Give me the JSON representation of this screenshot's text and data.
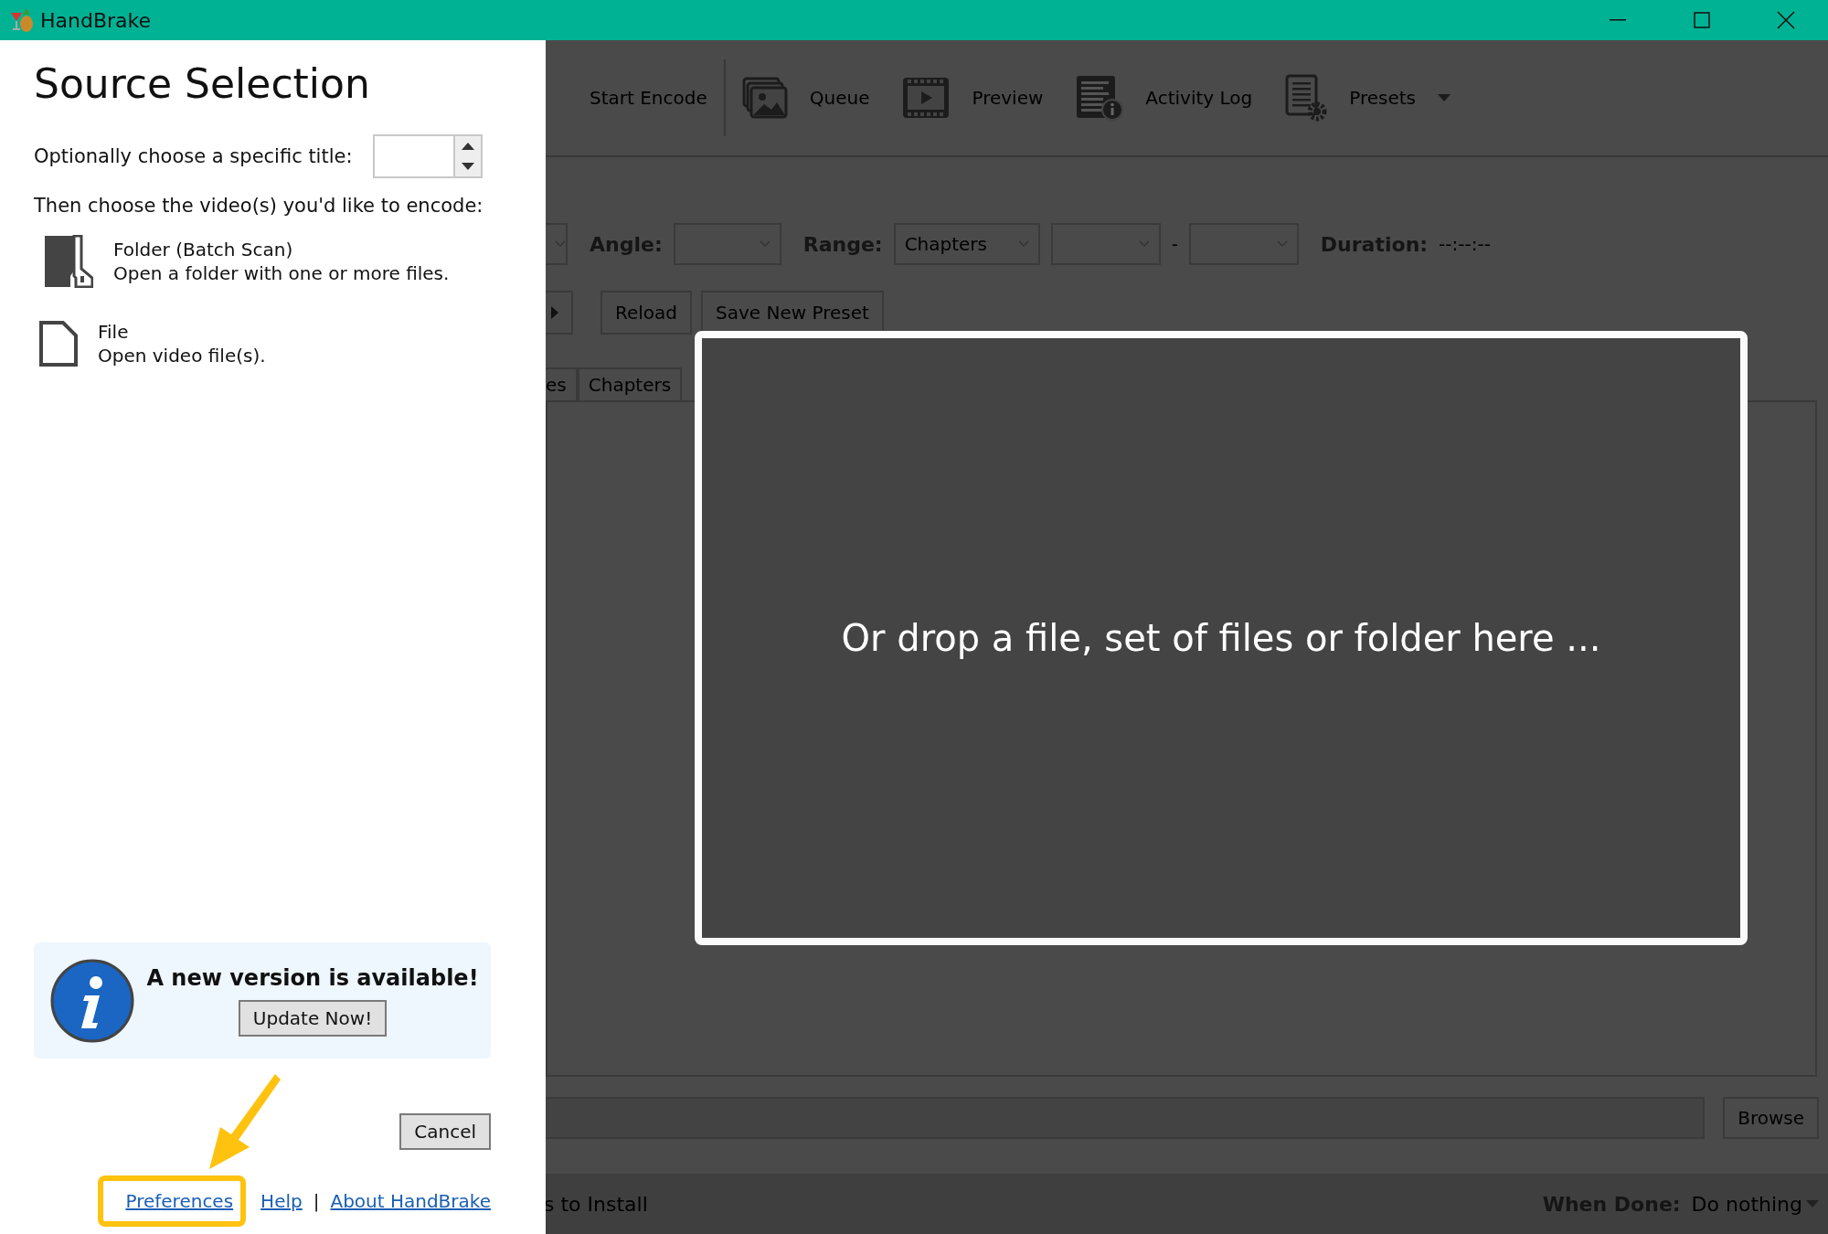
{
  "window": {
    "title": "HandBrake"
  },
  "source_selection": {
    "heading": "Source Selection",
    "title_label": "Optionally choose a specific title:",
    "choose_label": "Then choose the video(s) you'd like to encode:",
    "options": [
      {
        "kind": "folder",
        "name": "Folder (Batch Scan)",
        "description": "Open a folder with one or more files."
      },
      {
        "kind": "file",
        "name": "File",
        "description": "Open video file(s)."
      }
    ],
    "update_notice": {
      "message": "A new version is available!",
      "button": "Update Now!"
    },
    "cancel_button": "Cancel",
    "links": [
      {
        "label": "Preferences",
        "highlighted": true
      },
      {
        "label": "Help",
        "highlighted": false
      },
      {
        "label": "About HandBrake",
        "highlighted": false
      }
    ],
    "link_separator": "|"
  },
  "toolbar": [
    {
      "kind": "start",
      "label": "Start Encode"
    },
    {
      "kind": "queue",
      "label": "Queue"
    },
    {
      "kind": "preview",
      "label": "Preview"
    },
    {
      "kind": "log",
      "label": "Activity Log"
    },
    {
      "kind": "presets",
      "label": "Presets"
    }
  ],
  "source_row": {
    "angle_label": "Angle:",
    "range_label": "Range:",
    "range_value": "Chapters",
    "range_separator": "-",
    "duration_label": "Duration:",
    "duration_value": "--:--:--"
  },
  "preset_buttons": [
    "Reload",
    "Save New Preset"
  ],
  "tabs": [
    {
      "label": "es"
    },
    {
      "label": "Chapters"
    }
  ],
  "drop_zone": {
    "message": "Or drop a file, set of files or folder here ..."
  },
  "destination": {
    "browse_button": "Browse"
  },
  "status_bar": {
    "message": "s to Install",
    "when_done_label": "When Done:",
    "when_done_value": "Do nothing"
  }
}
